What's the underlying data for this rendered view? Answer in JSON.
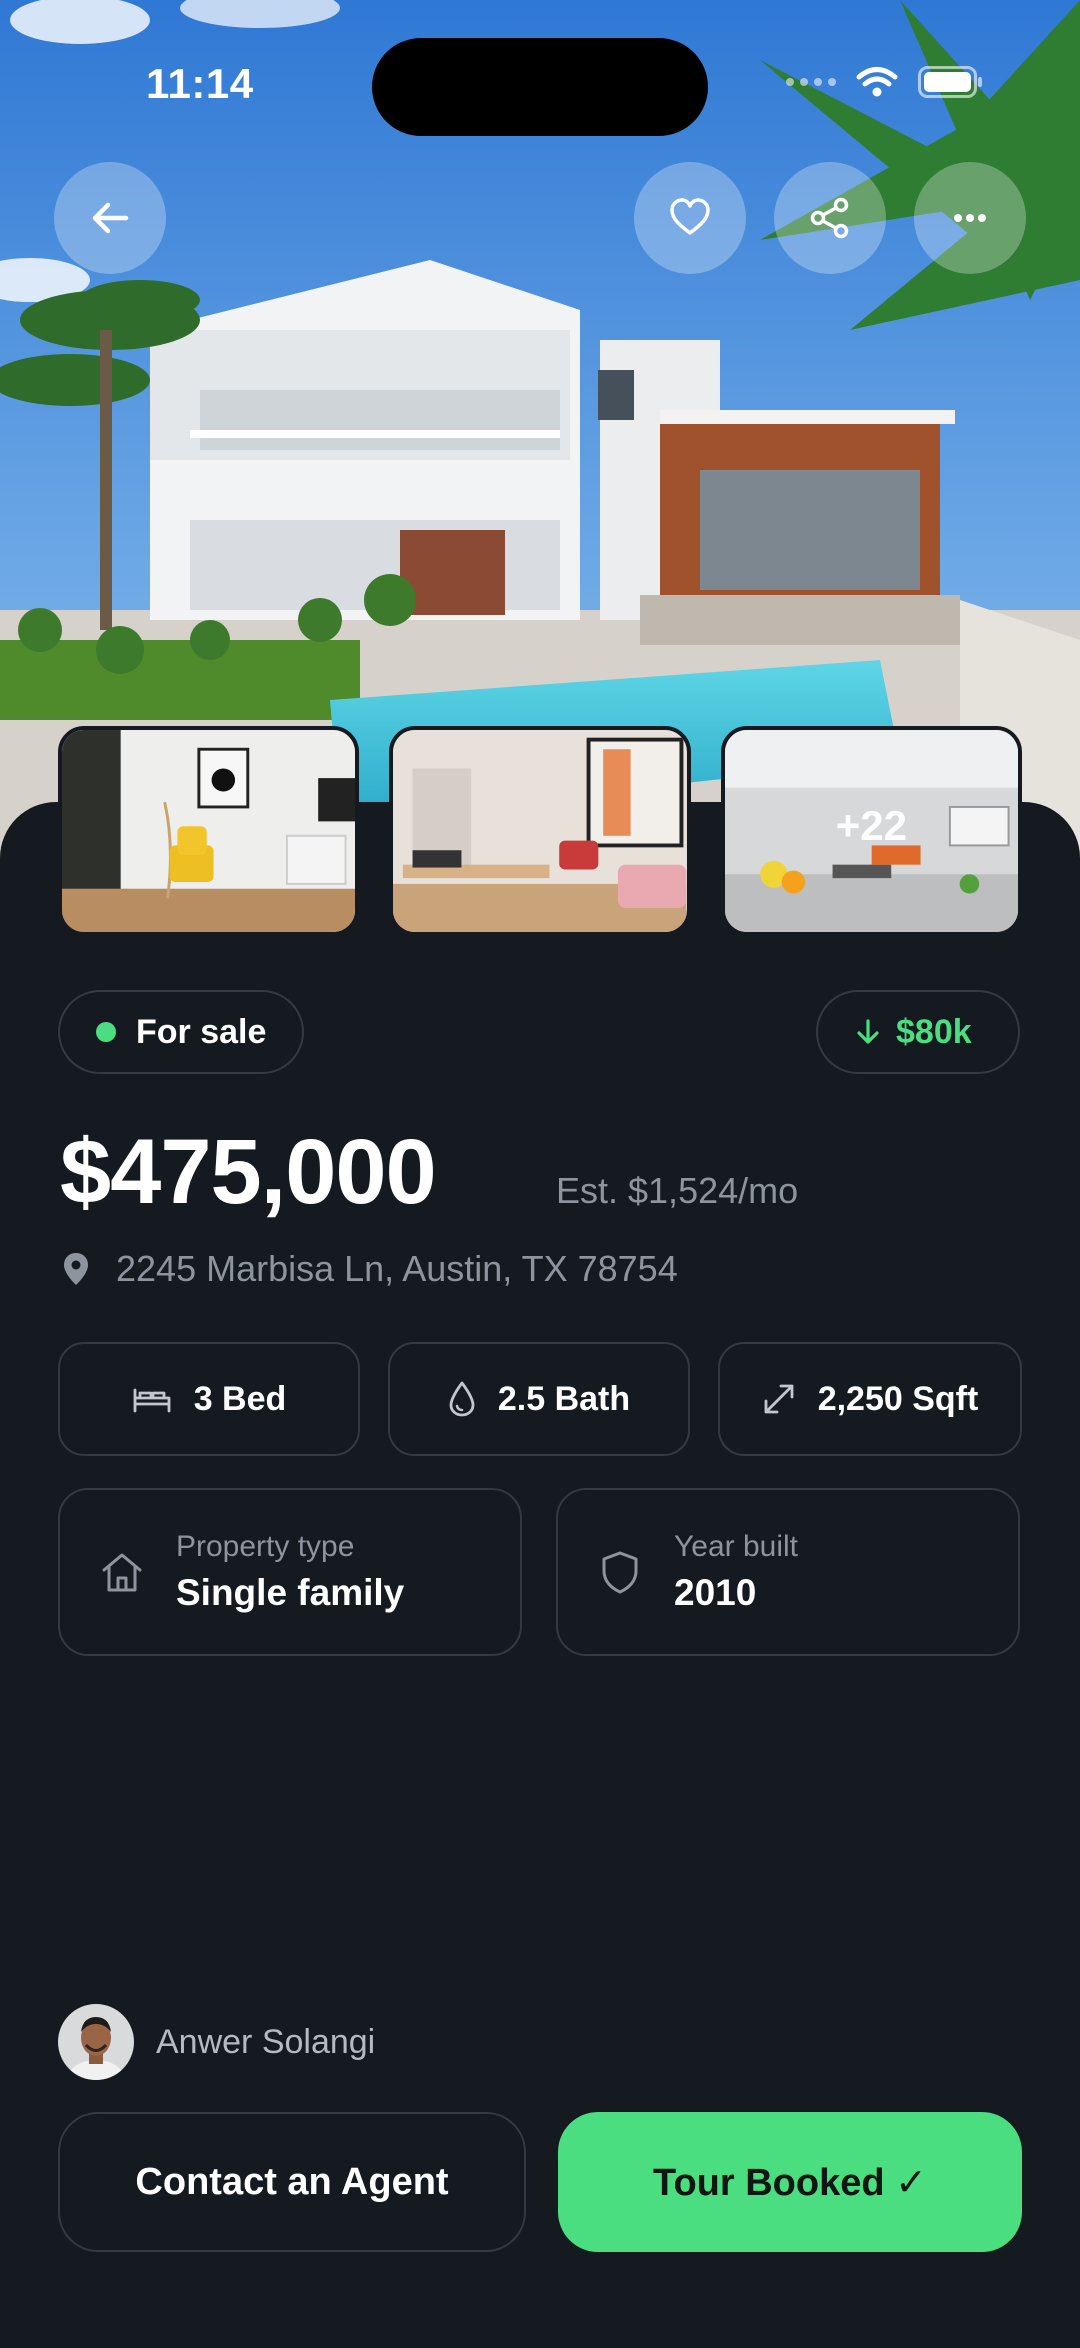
{
  "status_bar": {
    "time": "11:14"
  },
  "hero": {
    "back_icon": "arrow-left-icon",
    "actions": [
      "heart-icon",
      "share-icon",
      "more-horizontal-icon"
    ]
  },
  "gallery": {
    "more_count": "+22"
  },
  "listing": {
    "status": "For sale",
    "price_drop": "$80k",
    "price": "$475,000",
    "estimate": "Est. $1,524/mo",
    "address": "2245 Marbisa Ln, Austin, TX 78754",
    "features": [
      {
        "icon": "bed-icon",
        "label": "3 Bed"
      },
      {
        "icon": "drop-icon",
        "label": "2.5 Bath"
      },
      {
        "icon": "expand-arrows-icon",
        "label": "2,250 Sqft"
      }
    ],
    "property_type": {
      "label": "Property type",
      "value": "Single family"
    },
    "year_built": {
      "label": "Year built",
      "value": "2010"
    }
  },
  "agent": {
    "name": "Anwer Solangi"
  },
  "actions": {
    "contact": "Contact an Agent",
    "tour": "Tour Booked ✓"
  },
  "colors": {
    "background": "#151920",
    "accent": "#4ade80",
    "border": "#343a44",
    "muted": "#8d949e"
  }
}
